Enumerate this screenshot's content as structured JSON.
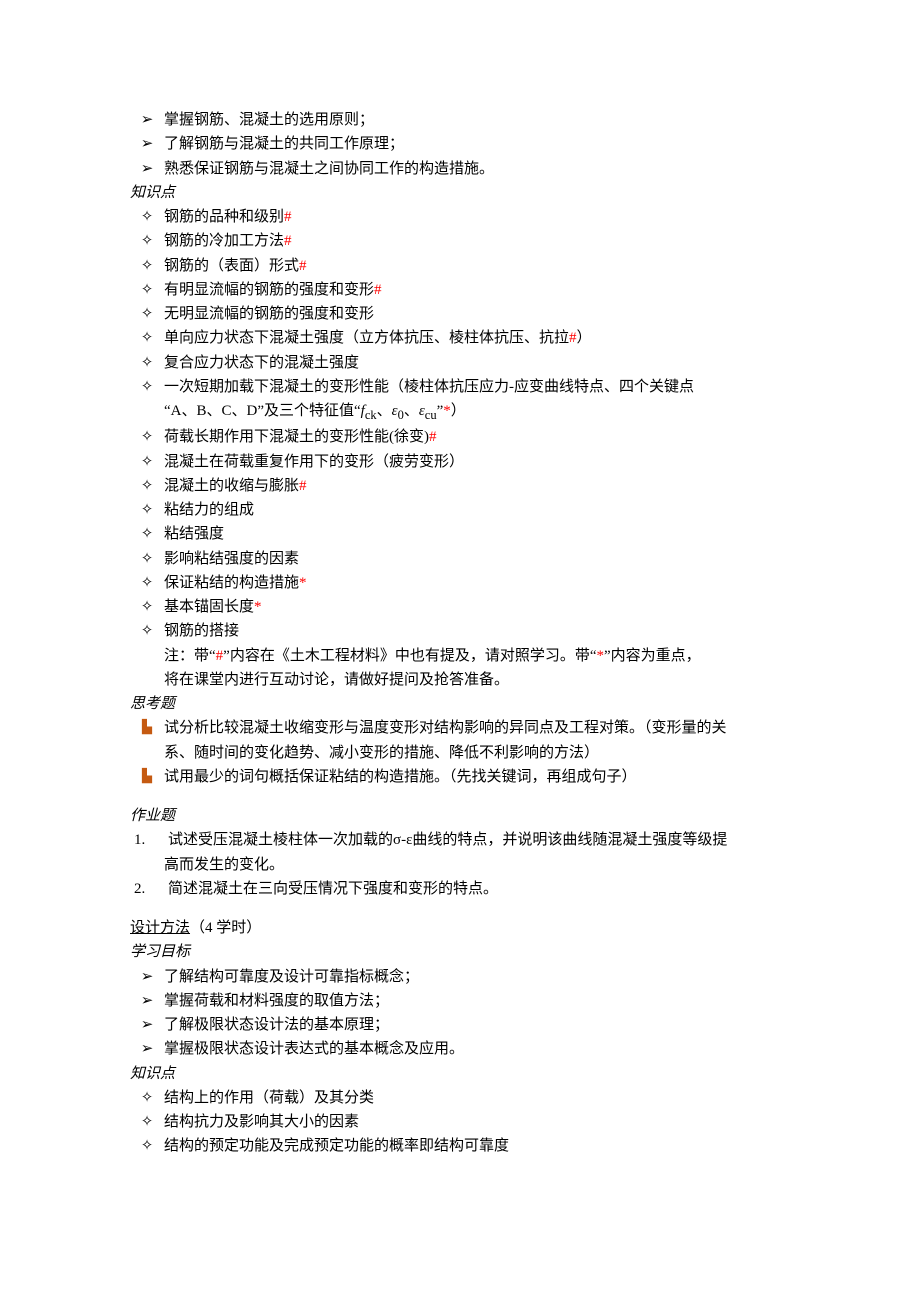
{
  "arrows1": [
    "掌握钢筋、混凝土的选用原则；",
    "了解钢筋与混凝土的共同工作原理；",
    " 熟悉保证钢筋与混凝土之间协同工作的构造措施。"
  ],
  "heading_knowledge": "知识点",
  "diamonds1": [
    {
      "text": "钢筋的品种和级别",
      "mark": "hash"
    },
    {
      "text": "钢筋的冷加工方法",
      "mark": "hash"
    },
    {
      "text": "钢筋的（表面）形式",
      "mark": "hash"
    },
    {
      "text": "有明显流幅的钢筋的强度和变形",
      "mark": "hash"
    },
    {
      "text": "无明显流幅的钢筋的强度和变形",
      "mark": ""
    },
    {
      "text": "单向应力状态下混凝土强度（立方体抗压、棱柱体抗压、抗拉",
      "mark": "hash",
      "tail": "）"
    },
    {
      "text": "复合应力状态下的混凝土强度",
      "mark": ""
    }
  ],
  "diamond_longterm_pre": " 一次短期加载下混凝土的变形性能（棱柱体抗压应力-应变曲线特点、四个关键点",
  "diamond_longterm_line2_a": "“A、B、C、D”及三个特征值“",
  "fck": "f",
  "fck_sub": "ck",
  "eps0": "ε",
  "eps0_sub": "0",
  "epscu": "ε",
  "epscu_sub": "cu",
  "diamond_longterm_line2_b": "”",
  "diamond_longterm_line2_c": "）",
  "diamonds2": [
    {
      "text": "荷载长期作用下混凝土的变形性能(徐变)",
      "mark": "hash"
    },
    {
      "text": "混凝土在荷载重复作用下的变形（疲劳变形）",
      "mark": ""
    },
    {
      "text": "混凝土的收缩与膨胀",
      "mark": "hash"
    },
    {
      "text": "粘结力的组成",
      "mark": ""
    },
    {
      "text": "粘结强度",
      "mark": ""
    },
    {
      "text": "影响粘结强度的因素",
      "mark": ""
    },
    {
      "text": "保证粘结的构造措施",
      "mark": "star"
    },
    {
      "text": "基本锚固长度",
      "mark": "star"
    },
    {
      "text": "钢筋的搭接",
      "mark": ""
    }
  ],
  "note_line1_a": "注：带“",
  "note_hash": "#",
  "note_line1_b": "”内容在《土木工程材料》中也有提及，请对照学习。带“",
  "note_star": "*",
  "note_line1_c": "”内容为重点，",
  "note_line2": "将在课堂内进行互动讨论，请做好提问及抢答准备。",
  "heading_think": "思考题",
  "flag1_line1": "试分析比较混凝土收缩变形与温度变形对结构影响的异同点及工程对策。（变形量的关",
  "flag1_line2": "系、随时间的变化趋势、减小变形的措施、降低不利影响的方法）",
  "flag2": "试用最少的词句概括保证粘结的构造措施。（先找关键词，再组成句子）",
  "heading_hw": "作业题",
  "hw1_line1": "试述受压混凝土棱柱体一次加载的σ-ε曲线的特点，并说明该曲线随混凝土强度等级提",
  "hw1_line2": "高而发生的变化。",
  "hw2": "简述混凝土在三向受压情况下强度和变形的特点。",
  "section2_title": "设计方法",
  "section2_hours": "（4 学时）",
  "heading_goal": "学习目标",
  "arrows2": [
    "了解结构可靠度及设计可靠指标概念；",
    "掌握荷载和材料强度的取值方法；",
    "了解极限状态设计法的基本原理；",
    "掌握极限状态设计表达式的基本概念及应用。"
  ],
  "heading_knowledge2": "知识点",
  "diamonds3": [
    "结构上的作用（荷载）及其分类",
    "结构抗力及影响其大小的因素",
    "结构的预定功能及完成预定功能的概率即结构可靠度"
  ],
  "num1": "1.",
  "num2": "2.",
  "sep1": "、",
  "sep2": "、"
}
